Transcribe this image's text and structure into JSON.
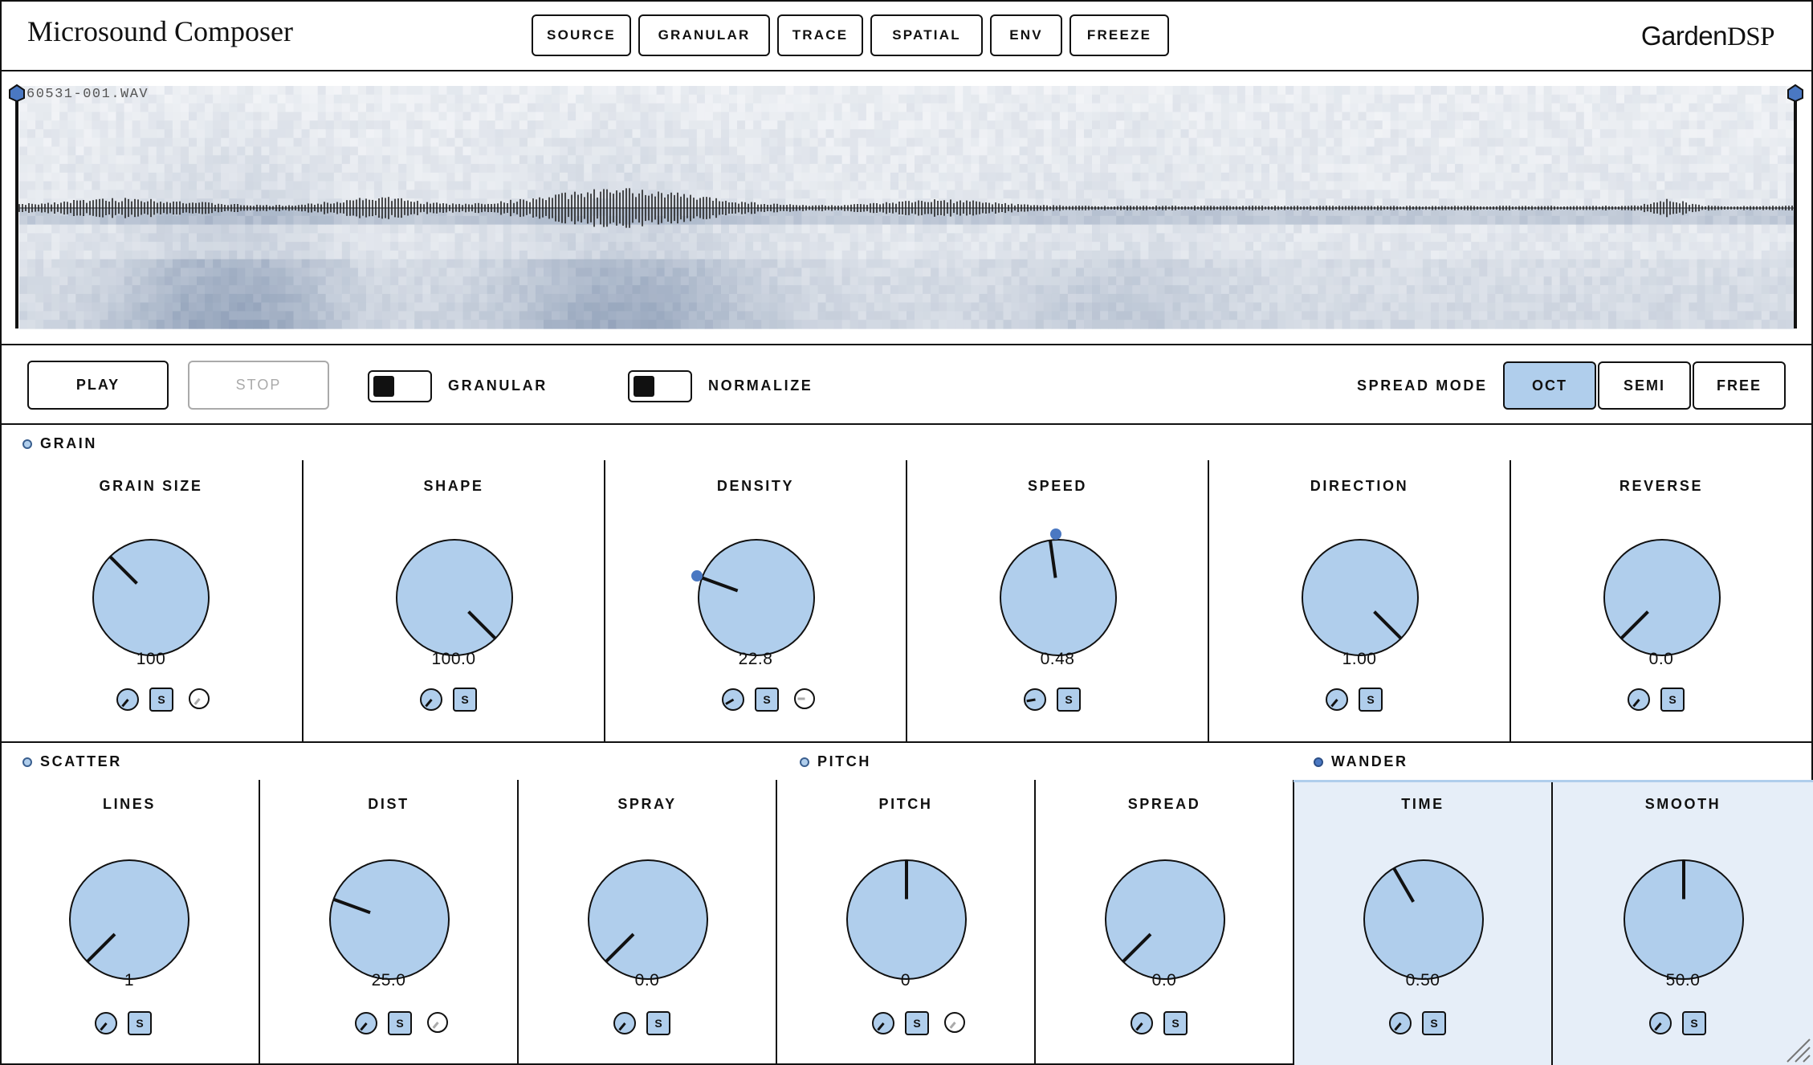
{
  "app": {
    "title": "Microsound Composer",
    "brand_a": "Garden",
    "brand_b": "DSP"
  },
  "tabs": [
    "SOURCE",
    "GRANULAR",
    "TRACE",
    "SPATIAL",
    "ENV",
    "FREEZE"
  ],
  "waveform": {
    "file_name": "60531-001.WAV"
  },
  "transport": {
    "play": "PLAY",
    "stop": "STOP",
    "granular_label": "GRANULAR",
    "normalize_label": "NORMALIZE",
    "spread_mode_label": "SPREAD MODE",
    "spread_modes": [
      "OCT",
      "SEMI",
      "FREE"
    ],
    "spread_mode_selected": "OCT"
  },
  "sections": {
    "grain": "GRAIN",
    "scatter": "SCATTER",
    "pitch": "PITCH",
    "wander": "WANDER"
  },
  "grain_params": [
    {
      "name": "GRAIN SIZE",
      "value": "100"
    },
    {
      "name": "SHAPE",
      "value": "100.0"
    },
    {
      "name": "DENSITY",
      "value": "22.8"
    },
    {
      "name": "SPEED",
      "value": "0.48"
    },
    {
      "name": "DIRECTION",
      "value": "1.00"
    },
    {
      "name": "REVERSE",
      "value": "0.0"
    }
  ],
  "lower_params": [
    {
      "name": "LINES",
      "value": "1"
    },
    {
      "name": "DIST",
      "value": "25.0"
    },
    {
      "name": "SPRAY",
      "value": "0.0"
    },
    {
      "name": "PITCH",
      "value": "0"
    },
    {
      "name": "SPREAD",
      "value": "0.0"
    },
    {
      "name": "TIME",
      "value": "0.50"
    },
    {
      "name": "SMOOTH",
      "value": "50.0"
    }
  ],
  "solo_label": "S",
  "colors": {
    "knob_fill": "#b0ceec",
    "accent": "#4a78c2",
    "highlight_bg": "#e6eef8"
  }
}
